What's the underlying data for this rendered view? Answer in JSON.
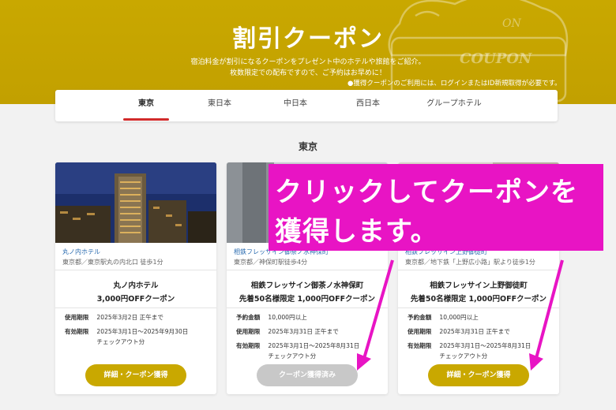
{
  "hero": {
    "title": "割引クーポン",
    "line1": "宿泊料金が割引になるクーポンをプレゼント中のホテルや旅館をご紹介。",
    "line2": "枚数限定での配布ですので、ご予約はお早めに！",
    "note": "●獲得クーポンのご利用には、ログインまたはID新規取得が必要です。",
    "art_on": "ON",
    "art_coupon": "COUPON"
  },
  "tabs": [
    {
      "label": "東京",
      "active": true
    },
    {
      "label": "東日本",
      "active": false
    },
    {
      "label": "中日本",
      "active": false
    },
    {
      "label": "西日本",
      "active": false
    },
    {
      "label": "グループホテル",
      "active": false
    }
  ],
  "section_title": "東京",
  "cards": [
    {
      "hotel": "丸ノ内ホテル",
      "location": "東京都／東京駅丸の内北口 徒歩1分",
      "name_line1": "丸ノ内ホテル",
      "name_line2": "3,000円OFFクーポン",
      "rows": [
        {
          "label": "使用期限",
          "value": "2025年3月2日 正午まで"
        },
        {
          "label": "有効期限",
          "value": "2025年3月1日〜2025年9月30日",
          "value2": "チェックアウト分"
        }
      ],
      "button": "詳細・クーポン獲得",
      "button_disabled": false
    },
    {
      "hotel": "相鉄フレッサイン御茶ノ水神保町",
      "location": "東京都／神保町駅徒歩4分",
      "name_line1": "相鉄フレッサイン御茶ノ水神保町",
      "name_line2": "先着50名様限定 1,000円OFFクーポン",
      "rows": [
        {
          "label": "予約金額",
          "value": "10,000円以上"
        },
        {
          "label": "使用期限",
          "value": "2025年3月31日 正午まで"
        },
        {
          "label": "有効期限",
          "value": "2025年3月1日〜2025年8月31日",
          "value2": "チェックアウト分"
        }
      ],
      "button": "クーポン獲得済み",
      "button_disabled": true
    },
    {
      "hotel": "相鉄フレッサイン上野御徒町",
      "location": "東京都／地下鉄「上野広小路」駅より徒歩1分",
      "name_line1": "相鉄フレッサイン上野御徒町",
      "name_line2": "先着50名様限定 1,000円OFFクーポン",
      "rows": [
        {
          "label": "予約金額",
          "value": "10,000円以上"
        },
        {
          "label": "使用期限",
          "value": "2025年3月31日 正午まで"
        },
        {
          "label": "有効期限",
          "value": "2025年3月1日〜2025年8月31日",
          "value2": "チェックアウト分"
        }
      ],
      "button": "詳細・クーポン獲得",
      "button_disabled": false
    }
  ],
  "overlay": {
    "line1": "クリックしてクーポンを",
    "line2": "獲得します。"
  },
  "colors": {
    "gold": "#c9a800",
    "tab_underline": "#d12a2a",
    "overlay": "#e814c4",
    "link_blue": "#2b6cb0"
  }
}
